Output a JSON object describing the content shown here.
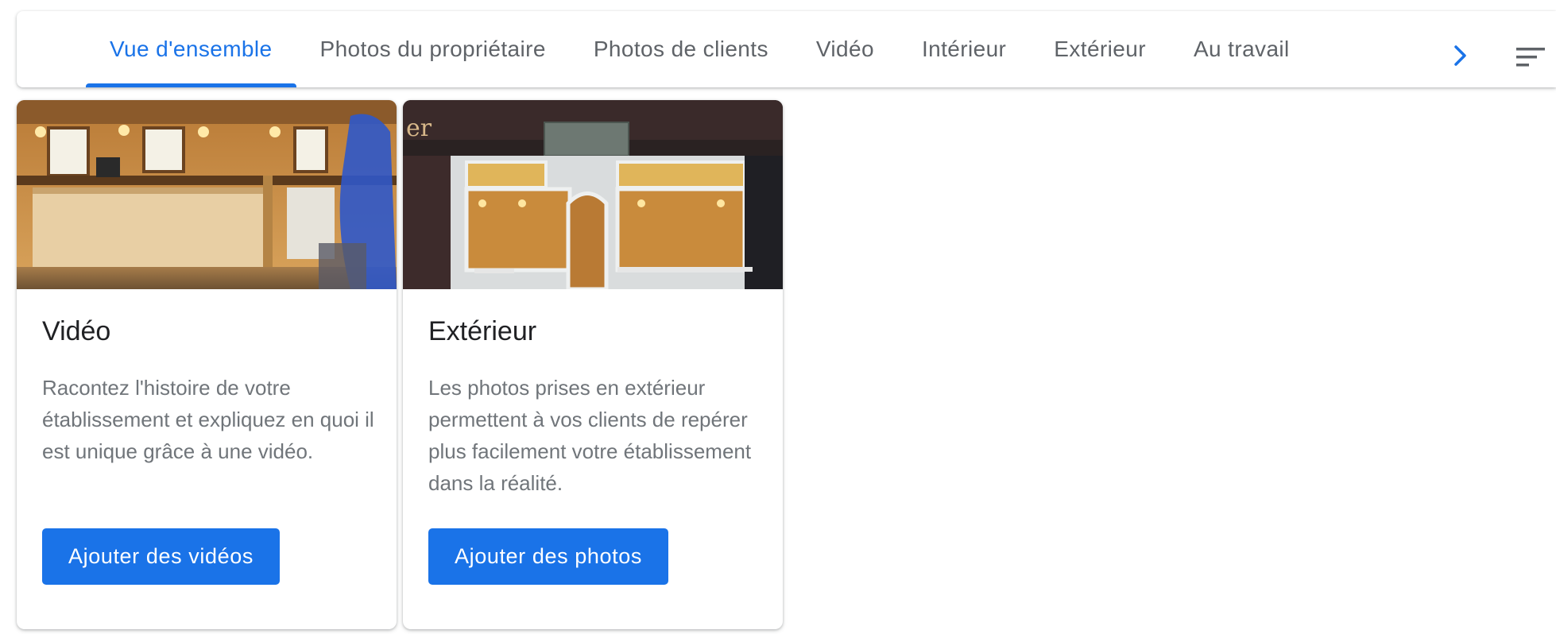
{
  "tabs": [
    {
      "label": "Vue d'ensemble",
      "active": true
    },
    {
      "label": "Photos du propriétaire",
      "active": false
    },
    {
      "label": "Photos de clients",
      "active": false
    },
    {
      "label": "Vidéo",
      "active": false
    },
    {
      "label": "Intérieur",
      "active": false
    },
    {
      "label": "Extérieur",
      "active": false
    },
    {
      "label": "Au travail",
      "active": false
    }
  ],
  "controls": {
    "next_icon": "chevron-right-icon",
    "sort_icon": "sort-icon"
  },
  "cards": [
    {
      "title": "Vidéo",
      "description": "Racontez l'histoire de votre établissement et expliquez en quoi il est unique grâce à une vidéo.",
      "button_label": "Ajouter des vidéos",
      "image": "shop-interior-photo"
    },
    {
      "title": "Extérieur",
      "description": "Les photos prises en extérieur permettent à vos clients de repérer plus facilement votre établissement dans la réalité.",
      "button_label": "Ajouter des photos",
      "image": "storefront-exterior-photo"
    }
  ],
  "colors": {
    "accent": "#1a73e8",
    "tab_text": "#5f6368",
    "desc_text": "#70757a"
  }
}
